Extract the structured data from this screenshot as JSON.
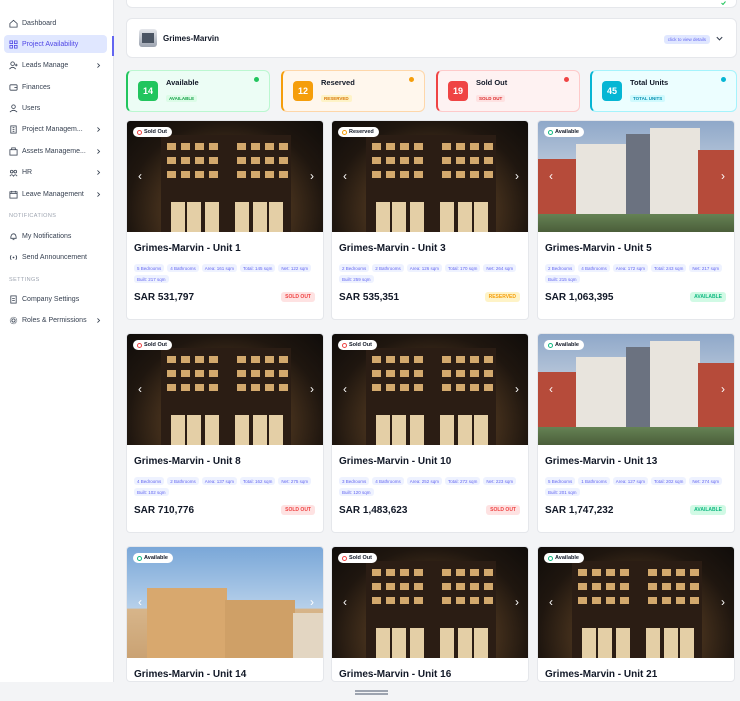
{
  "sidebar": {
    "items": [
      {
        "label": "Dashboard",
        "icon": "home-icon",
        "active": false,
        "chevron": false
      },
      {
        "label": "Project Availability",
        "icon": "grid-icon",
        "active": true,
        "chevron": false
      },
      {
        "label": "Leads Manage",
        "icon": "user-plus-icon",
        "active": false,
        "chevron": true
      },
      {
        "label": "Finances",
        "icon": "wallet-icon",
        "active": false,
        "chevron": false
      },
      {
        "label": "Users",
        "icon": "user-icon",
        "active": false,
        "chevron": false
      },
      {
        "label": "Project Managem...",
        "icon": "building-icon",
        "active": false,
        "chevron": true
      },
      {
        "label": "Assets Manageme...",
        "icon": "assets-icon",
        "active": false,
        "chevron": true
      },
      {
        "label": "HR",
        "icon": "hr-icon",
        "active": false,
        "chevron": true
      },
      {
        "label": "Leave Management",
        "icon": "calendar-icon",
        "active": false,
        "chevron": true
      }
    ],
    "notifications_label": "NOTIFICATIONS",
    "notification_items": [
      {
        "label": "My Notifications",
        "icon": "bell-icon"
      },
      {
        "label": "Send Announcement",
        "icon": "broadcast-icon"
      }
    ],
    "settings_label": "SETTINGS",
    "settings_items": [
      {
        "label": "Company Settings",
        "icon": "document-icon",
        "chevron": false
      },
      {
        "label": "Roles & Permissions",
        "icon": "gear-icon",
        "chevron": true
      }
    ]
  },
  "project": {
    "name": "Grimes-Marvin",
    "hint": "click to view details"
  },
  "stats": [
    {
      "count": "14",
      "label": "Available",
      "pill": "AVAILABLE",
      "color": "#22c55e",
      "bg": "#ecfdf5",
      "border": "#bbf7d0",
      "pill_bg": "#dcfce7",
      "pill_fg": "#16a34a"
    },
    {
      "count": "12",
      "label": "Reserved",
      "pill": "RESERVED",
      "color": "#f59e0b",
      "bg": "#fff7ed",
      "border": "#fed7aa",
      "pill_bg": "#fef3c7",
      "pill_fg": "#d97706"
    },
    {
      "count": "19",
      "label": "Sold Out",
      "pill": "SOLD OUT",
      "color": "#ef4444",
      "bg": "#fef2f2",
      "border": "#fecaca",
      "pill_bg": "#fee2e2",
      "pill_fg": "#dc2626"
    },
    {
      "count": "45",
      "label": "Total Units",
      "pill": "TOTAL UNITS",
      "color": "#06b6d4",
      "bg": "#ecfeff",
      "border": "#a5f3fc",
      "pill_bg": "#cffafe",
      "pill_fg": "#0891b2"
    }
  ],
  "units": [
    {
      "title": "Grimes-Marvin - Unit 1",
      "badge": "Sold Out",
      "scene": "night",
      "tags": [
        "5 Bedrooms",
        "4 Bathrooms",
        "Area: 161 sqm",
        "Total: 145 sqm",
        "Net: 122 sqm",
        "Built: 217 sqm"
      ],
      "price": "SAR 531,797",
      "status": "SOLD OUT",
      "status_class": "sold"
    },
    {
      "title": "Grimes-Marvin - Unit 3",
      "badge": "Reserved",
      "scene": "night",
      "tags": [
        "2 Bedrooms",
        "2 Bathrooms",
        "Area: 126 sqm",
        "Total: 170 sqm",
        "Net: 264 sqm",
        "Built: 259 sqm"
      ],
      "price": "SAR 535,351",
      "status": "RESERVED",
      "status_class": "reserved"
    },
    {
      "title": "Grimes-Marvin - Unit 5",
      "badge": "Available",
      "scene": "day",
      "tags": [
        "2 Bedrooms",
        "4 Bathrooms",
        "Area: 172 sqm",
        "Total: 243 sqm",
        "Net: 217 sqm",
        "Built: 215 sqm"
      ],
      "price": "SAR 1,063,395",
      "status": "AVAILABLE",
      "status_class": "available"
    },
    {
      "title": "Grimes-Marvin - Unit 8",
      "badge": "Sold Out",
      "scene": "night",
      "tags": [
        "4 Bedrooms",
        "2 Bathrooms",
        "Area: 137 sqm",
        "Total: 162 sqm",
        "Net: 275 sqm",
        "Built: 102 sqm"
      ],
      "price": "SAR 710,776",
      "status": "SOLD OUT",
      "status_class": "sold"
    },
    {
      "title": "Grimes-Marvin - Unit 10",
      "badge": "Sold Out",
      "scene": "night",
      "tags": [
        "3 Bedrooms",
        "4 Bathrooms",
        "Area: 252 sqm",
        "Total: 272 sqm",
        "Net: 223 sqm",
        "Built: 120 sqm"
      ],
      "price": "SAR 1,483,623",
      "status": "SOLD OUT",
      "status_class": "sold"
    },
    {
      "title": "Grimes-Marvin - Unit 13",
      "badge": "Available",
      "scene": "day",
      "tags": [
        "5 Bedrooms",
        "1 Bathrooms",
        "Area: 127 sqm",
        "Total: 202 sqm",
        "Net: 274 sqm",
        "Built: 201 sqm"
      ],
      "price": "SAR 1,747,232",
      "status": "AVAILABLE",
      "status_class": "available"
    },
    {
      "title": "Grimes-Marvin - Unit 14",
      "badge": "Available",
      "scene": "town",
      "tags": [],
      "price": "",
      "status": "",
      "status_class": ""
    },
    {
      "title": "Grimes-Marvin - Unit 16",
      "badge": "Sold Out",
      "scene": "night",
      "tags": [],
      "price": "",
      "status": "",
      "status_class": ""
    },
    {
      "title": "Grimes-Marvin - Unit 21",
      "badge": "Available",
      "scene": "night",
      "tags": [],
      "price": "",
      "status": "",
      "status_class": ""
    }
  ],
  "colors": {
    "accent": "#6366f1",
    "sold": "#ef4444",
    "reserved": "#f59e0b",
    "available": "#10b981"
  }
}
